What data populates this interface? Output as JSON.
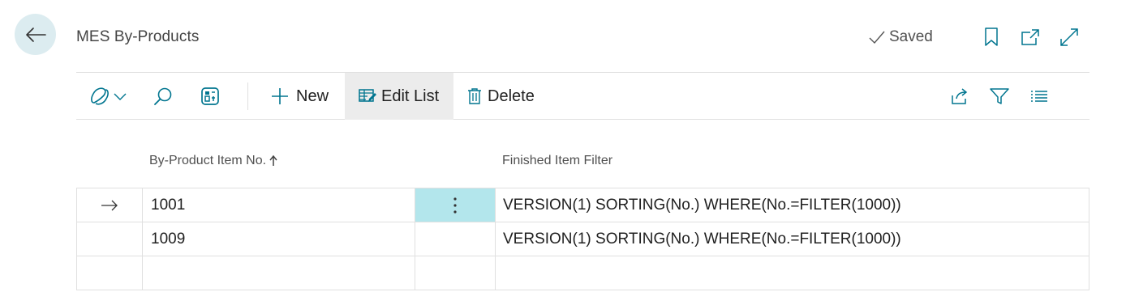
{
  "header": {
    "title": "MES By-Products",
    "saved_label": "Saved"
  },
  "action_bar": {
    "new_label": "New",
    "edit_list_label": "Edit List",
    "delete_label": "Delete"
  },
  "table": {
    "columns": [
      {
        "label": "By-Product Item No.",
        "sort": "ascending"
      },
      {
        "label": "Finished Item Filter"
      }
    ],
    "rows": [
      {
        "item_no": "1001",
        "filter": "VERSION(1) SORTING(No.) WHERE(No.=FILTER(1000))",
        "selected": true
      },
      {
        "item_no": "1009",
        "filter": "VERSION(1) SORTING(No.) WHERE(No.=FILTER(1000))",
        "selected": false
      },
      {
        "item_no": "",
        "filter": "",
        "selected": false
      }
    ]
  },
  "colors": {
    "accent": "#00758f",
    "back_button_bg": "#dcecf0",
    "selected_cell_bg": "#b3e6ec",
    "active_action_bg": "#ececec"
  }
}
